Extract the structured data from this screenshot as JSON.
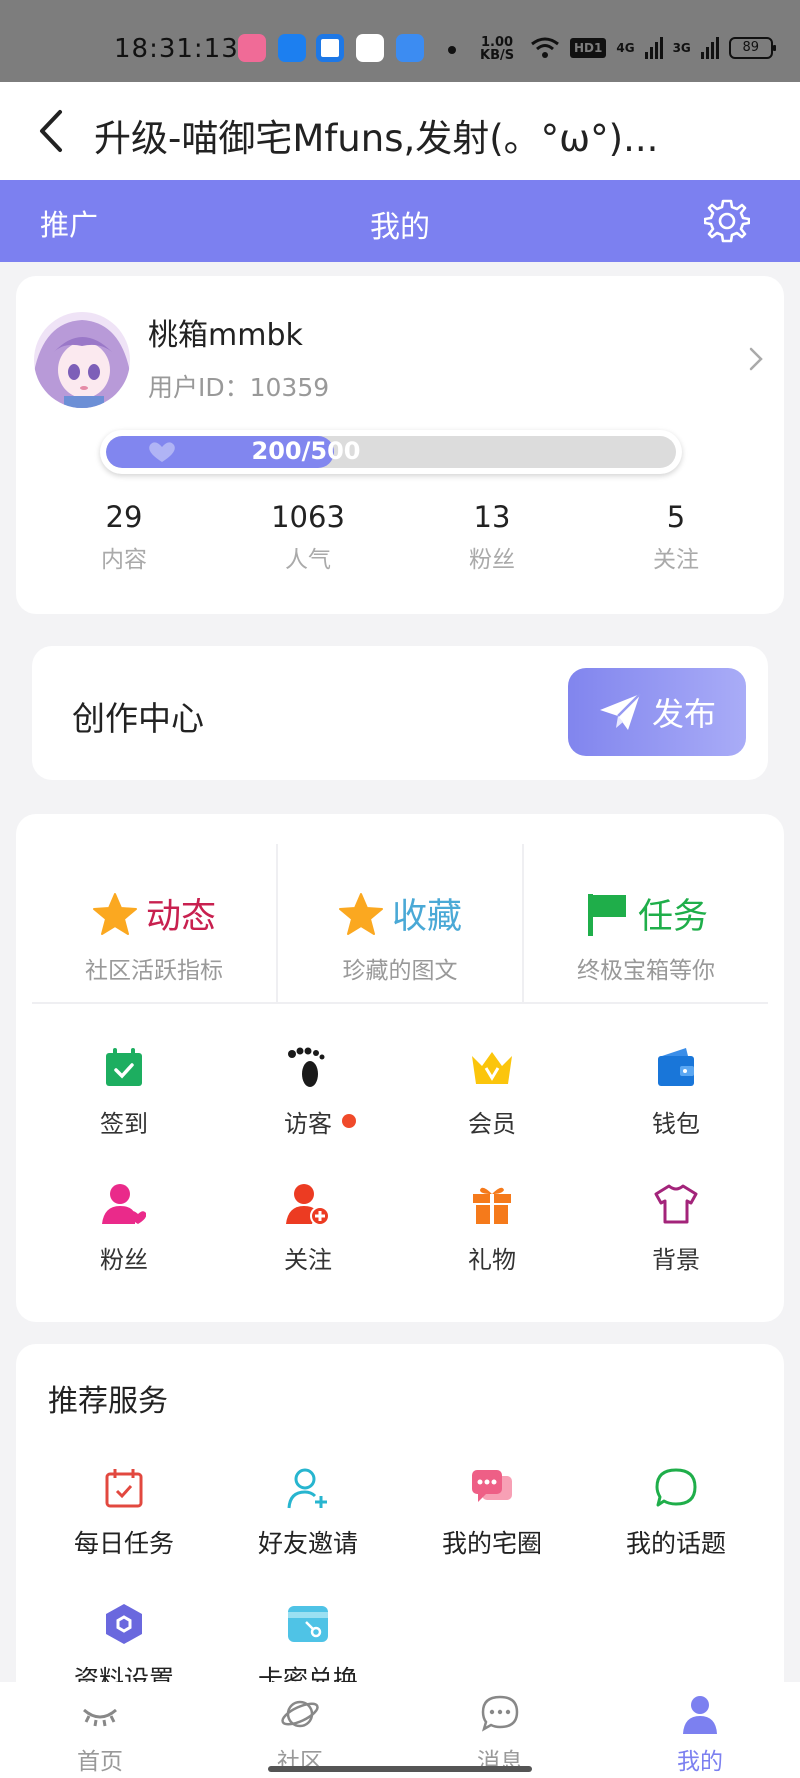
{
  "status_bar": {
    "time": "18:31:13",
    "net_speed_value": "1.00",
    "net_speed_unit": "KB/S",
    "hd_label": "HD1",
    "signal1": "4G",
    "signal2": "3G",
    "battery": "89"
  },
  "header": {
    "title": "升级-喵御宅Mfuns,发射(。°ω°)..."
  },
  "tabs": {
    "promo": "推广",
    "mine": "我的"
  },
  "profile": {
    "username": "桃箱mmbk",
    "user_id_label": "用户ID：",
    "user_id": "10359",
    "progress_text": "200/500",
    "progress_fraction": 0.4,
    "stats": [
      {
        "value": "29",
        "label": "内容"
      },
      {
        "value": "1063",
        "label": "人气"
      },
      {
        "value": "13",
        "label": "粉丝"
      },
      {
        "value": "5",
        "label": "关注"
      }
    ]
  },
  "creation": {
    "title": "创作中心",
    "publish_label": "发布"
  },
  "features": [
    {
      "name": "动态",
      "sub": "社区活跃指标",
      "color": "#c8204f",
      "icon": "star-icon"
    },
    {
      "name": "收藏",
      "sub": "珍藏的图文",
      "color": "#4aa9d6",
      "icon": "star-icon"
    },
    {
      "name": "任务",
      "sub": "终极宝箱等你",
      "color": "#1fae4a",
      "icon": "flag-icon"
    }
  ],
  "grid_row1": [
    {
      "label": "签到",
      "icon": "calendar-check-icon"
    },
    {
      "label": "访客",
      "icon": "footprints-icon",
      "badge": true
    },
    {
      "label": "会员",
      "icon": "crown-icon"
    },
    {
      "label": "钱包",
      "icon": "wallet-icon"
    }
  ],
  "grid_row2": [
    {
      "label": "粉丝",
      "icon": "user-heart-icon"
    },
    {
      "label": "关注",
      "icon": "user-add-icon"
    },
    {
      "label": "礼物",
      "icon": "gift-icon"
    },
    {
      "label": "背景",
      "icon": "shirt-icon"
    }
  ],
  "services": {
    "title": "推荐服务",
    "row1": [
      {
        "label": "每日任务",
        "icon": "daily-task-icon"
      },
      {
        "label": "好友邀请",
        "icon": "invite-friend-icon"
      },
      {
        "label": "我的宅圈",
        "icon": "chat-bubbles-icon"
      },
      {
        "label": "我的话题",
        "icon": "speech-bubble-icon"
      }
    ],
    "row2": [
      {
        "label": "资料设置",
        "icon": "hexagon-settings-icon"
      },
      {
        "label": "卡密兑换",
        "icon": "card-key-icon"
      }
    ]
  },
  "bottom_nav": [
    {
      "label": "首页",
      "icon": "eye-closed-icon"
    },
    {
      "label": "社区",
      "icon": "planet-icon"
    },
    {
      "label": "消息",
      "icon": "message-icon"
    },
    {
      "label": "我的",
      "icon": "person-icon",
      "active": true
    }
  ],
  "colors": {
    "accent": "#7c80f0"
  }
}
